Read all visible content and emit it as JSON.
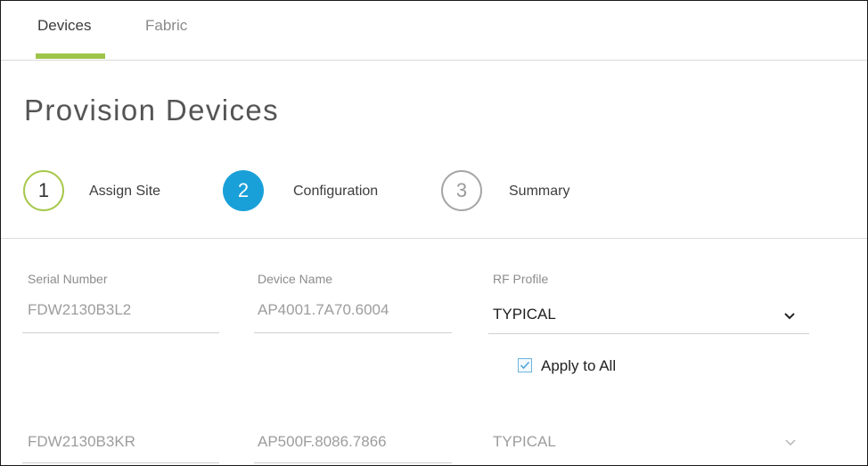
{
  "tabs": [
    {
      "label": "Devices",
      "active": true
    },
    {
      "label": "Fabric",
      "active": false
    }
  ],
  "page_title": "Provision Devices",
  "steps": [
    {
      "number": "1",
      "label": "Assign Site",
      "state": "done"
    },
    {
      "number": "2",
      "label": "Configuration",
      "state": "active"
    },
    {
      "number": "3",
      "label": "Summary",
      "state": "pending"
    }
  ],
  "table": {
    "headers": {
      "serial_number": "Serial Number",
      "device_name": "Device Name",
      "rf_profile": "RF Profile"
    },
    "rows": [
      {
        "serial_number": "FDW2130B3L2",
        "device_name": "AP4001.7A70.6004",
        "rf_profile": "TYPICAL"
      },
      {
        "serial_number": "FDW2130B3KR",
        "device_name": "AP500F.8086.7866",
        "rf_profile": "TYPICAL"
      }
    ]
  },
  "apply_to_all": {
    "label": "Apply to All",
    "checked": true
  },
  "icons": {
    "dropdown": "chevron-down-icon",
    "checkmark": "checkmark-icon"
  },
  "colors": {
    "tab_active_underline": "#9fc44a",
    "step_done_border": "#a7c84d",
    "step_active_fill": "#1aa0d8",
    "step_pending_border": "#a6a6a6",
    "checkbox_border": "#6bb4e0"
  }
}
